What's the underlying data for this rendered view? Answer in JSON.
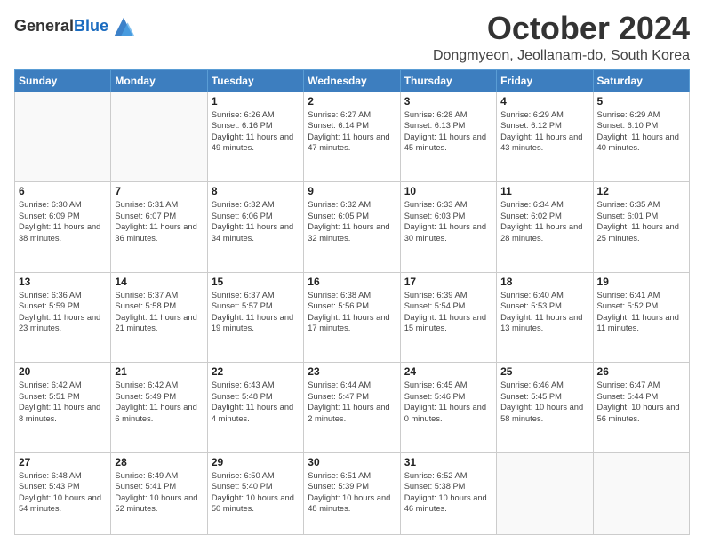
{
  "logo": {
    "general": "General",
    "blue": "Blue"
  },
  "header": {
    "month": "October 2024",
    "location": "Dongmyeon, Jeollanam-do, South Korea"
  },
  "weekdays": [
    "Sunday",
    "Monday",
    "Tuesday",
    "Wednesday",
    "Thursday",
    "Friday",
    "Saturday"
  ],
  "weeks": [
    [
      {
        "day": "",
        "sunrise": "",
        "sunset": "",
        "daylight": ""
      },
      {
        "day": "",
        "sunrise": "",
        "sunset": "",
        "daylight": ""
      },
      {
        "day": "1",
        "sunrise": "Sunrise: 6:26 AM",
        "sunset": "Sunset: 6:16 PM",
        "daylight": "Daylight: 11 hours and 49 minutes."
      },
      {
        "day": "2",
        "sunrise": "Sunrise: 6:27 AM",
        "sunset": "Sunset: 6:14 PM",
        "daylight": "Daylight: 11 hours and 47 minutes."
      },
      {
        "day": "3",
        "sunrise": "Sunrise: 6:28 AM",
        "sunset": "Sunset: 6:13 PM",
        "daylight": "Daylight: 11 hours and 45 minutes."
      },
      {
        "day": "4",
        "sunrise": "Sunrise: 6:29 AM",
        "sunset": "Sunset: 6:12 PM",
        "daylight": "Daylight: 11 hours and 43 minutes."
      },
      {
        "day": "5",
        "sunrise": "Sunrise: 6:29 AM",
        "sunset": "Sunset: 6:10 PM",
        "daylight": "Daylight: 11 hours and 40 minutes."
      }
    ],
    [
      {
        "day": "6",
        "sunrise": "Sunrise: 6:30 AM",
        "sunset": "Sunset: 6:09 PM",
        "daylight": "Daylight: 11 hours and 38 minutes."
      },
      {
        "day": "7",
        "sunrise": "Sunrise: 6:31 AM",
        "sunset": "Sunset: 6:07 PM",
        "daylight": "Daylight: 11 hours and 36 minutes."
      },
      {
        "day": "8",
        "sunrise": "Sunrise: 6:32 AM",
        "sunset": "Sunset: 6:06 PM",
        "daylight": "Daylight: 11 hours and 34 minutes."
      },
      {
        "day": "9",
        "sunrise": "Sunrise: 6:32 AM",
        "sunset": "Sunset: 6:05 PM",
        "daylight": "Daylight: 11 hours and 32 minutes."
      },
      {
        "day": "10",
        "sunrise": "Sunrise: 6:33 AM",
        "sunset": "Sunset: 6:03 PM",
        "daylight": "Daylight: 11 hours and 30 minutes."
      },
      {
        "day": "11",
        "sunrise": "Sunrise: 6:34 AM",
        "sunset": "Sunset: 6:02 PM",
        "daylight": "Daylight: 11 hours and 28 minutes."
      },
      {
        "day": "12",
        "sunrise": "Sunrise: 6:35 AM",
        "sunset": "Sunset: 6:01 PM",
        "daylight": "Daylight: 11 hours and 25 minutes."
      }
    ],
    [
      {
        "day": "13",
        "sunrise": "Sunrise: 6:36 AM",
        "sunset": "Sunset: 5:59 PM",
        "daylight": "Daylight: 11 hours and 23 minutes."
      },
      {
        "day": "14",
        "sunrise": "Sunrise: 6:37 AM",
        "sunset": "Sunset: 5:58 PM",
        "daylight": "Daylight: 11 hours and 21 minutes."
      },
      {
        "day": "15",
        "sunrise": "Sunrise: 6:37 AM",
        "sunset": "Sunset: 5:57 PM",
        "daylight": "Daylight: 11 hours and 19 minutes."
      },
      {
        "day": "16",
        "sunrise": "Sunrise: 6:38 AM",
        "sunset": "Sunset: 5:56 PM",
        "daylight": "Daylight: 11 hours and 17 minutes."
      },
      {
        "day": "17",
        "sunrise": "Sunrise: 6:39 AM",
        "sunset": "Sunset: 5:54 PM",
        "daylight": "Daylight: 11 hours and 15 minutes."
      },
      {
        "day": "18",
        "sunrise": "Sunrise: 6:40 AM",
        "sunset": "Sunset: 5:53 PM",
        "daylight": "Daylight: 11 hours and 13 minutes."
      },
      {
        "day": "19",
        "sunrise": "Sunrise: 6:41 AM",
        "sunset": "Sunset: 5:52 PM",
        "daylight": "Daylight: 11 hours and 11 minutes."
      }
    ],
    [
      {
        "day": "20",
        "sunrise": "Sunrise: 6:42 AM",
        "sunset": "Sunset: 5:51 PM",
        "daylight": "Daylight: 11 hours and 8 minutes."
      },
      {
        "day": "21",
        "sunrise": "Sunrise: 6:42 AM",
        "sunset": "Sunset: 5:49 PM",
        "daylight": "Daylight: 11 hours and 6 minutes."
      },
      {
        "day": "22",
        "sunrise": "Sunrise: 6:43 AM",
        "sunset": "Sunset: 5:48 PM",
        "daylight": "Daylight: 11 hours and 4 minutes."
      },
      {
        "day": "23",
        "sunrise": "Sunrise: 6:44 AM",
        "sunset": "Sunset: 5:47 PM",
        "daylight": "Daylight: 11 hours and 2 minutes."
      },
      {
        "day": "24",
        "sunrise": "Sunrise: 6:45 AM",
        "sunset": "Sunset: 5:46 PM",
        "daylight": "Daylight: 11 hours and 0 minutes."
      },
      {
        "day": "25",
        "sunrise": "Sunrise: 6:46 AM",
        "sunset": "Sunset: 5:45 PM",
        "daylight": "Daylight: 10 hours and 58 minutes."
      },
      {
        "day": "26",
        "sunrise": "Sunrise: 6:47 AM",
        "sunset": "Sunset: 5:44 PM",
        "daylight": "Daylight: 10 hours and 56 minutes."
      }
    ],
    [
      {
        "day": "27",
        "sunrise": "Sunrise: 6:48 AM",
        "sunset": "Sunset: 5:43 PM",
        "daylight": "Daylight: 10 hours and 54 minutes."
      },
      {
        "day": "28",
        "sunrise": "Sunrise: 6:49 AM",
        "sunset": "Sunset: 5:41 PM",
        "daylight": "Daylight: 10 hours and 52 minutes."
      },
      {
        "day": "29",
        "sunrise": "Sunrise: 6:50 AM",
        "sunset": "Sunset: 5:40 PM",
        "daylight": "Daylight: 10 hours and 50 minutes."
      },
      {
        "day": "30",
        "sunrise": "Sunrise: 6:51 AM",
        "sunset": "Sunset: 5:39 PM",
        "daylight": "Daylight: 10 hours and 48 minutes."
      },
      {
        "day": "31",
        "sunrise": "Sunrise: 6:52 AM",
        "sunset": "Sunset: 5:38 PM",
        "daylight": "Daylight: 10 hours and 46 minutes."
      },
      {
        "day": "",
        "sunrise": "",
        "sunset": "",
        "daylight": ""
      },
      {
        "day": "",
        "sunrise": "",
        "sunset": "",
        "daylight": ""
      }
    ]
  ]
}
